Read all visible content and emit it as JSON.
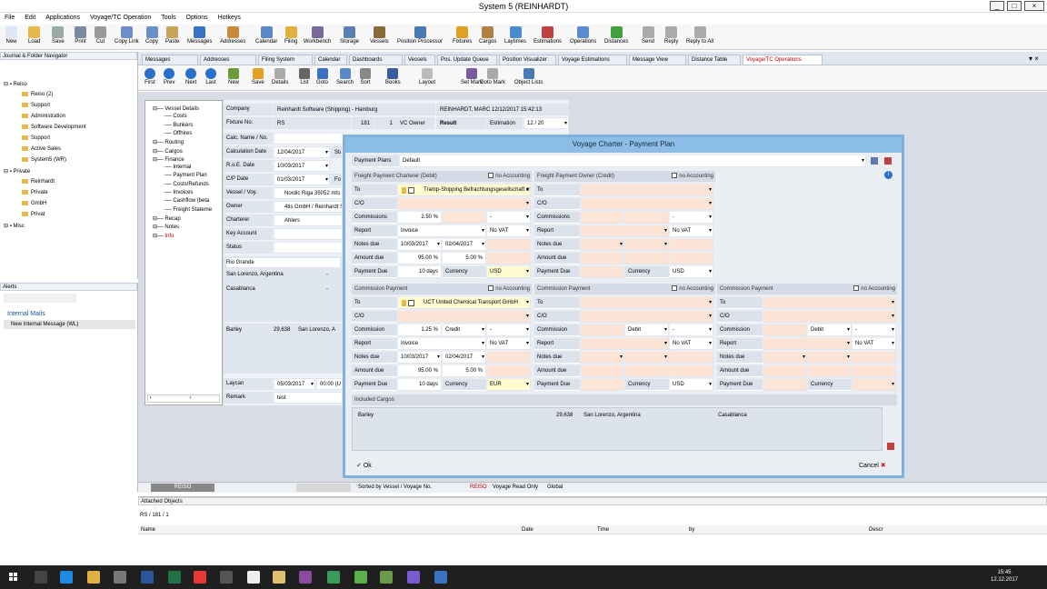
{
  "window": {
    "title": "System 5 (REINHARDT)",
    "min": "_",
    "max": "□",
    "close": "×"
  },
  "menu": [
    "File",
    "Edit",
    "Applications",
    "Voyage/TC Operation",
    "Tools",
    "Options",
    "Hotkeys"
  ],
  "ribbon": [
    "New",
    "Load",
    "Save",
    "Print",
    "Cut",
    "Copy Link",
    "Copy",
    "Paste",
    "Messages",
    "Addresses",
    "Calendar",
    "Filing",
    "Workbench",
    "Storage",
    "Vessels",
    "Position Processor",
    "Fixtures",
    "Cargos",
    "Laytimes",
    "Estimations",
    "Operations",
    "Distances",
    "Send",
    "Reply",
    "Reply to All"
  ],
  "nav": {
    "title": "Journal & Folder Navigator",
    "items": [
      {
        "label": "Reiso",
        "level": 0
      },
      {
        "label": "Reiso (2)",
        "level": 1
      },
      {
        "label": "Support",
        "level": 1
      },
      {
        "label": "Administration",
        "level": 1
      },
      {
        "label": "Software Development",
        "level": 1
      },
      {
        "label": "Support",
        "level": 1
      },
      {
        "label": "Active Sales",
        "level": 1
      },
      {
        "label": "System5 (WR)",
        "level": 1
      },
      {
        "label": "Private",
        "level": 0
      },
      {
        "label": "Reinhardt",
        "level": 1
      },
      {
        "label": "Private",
        "level": 1
      },
      {
        "label": "GmbH",
        "level": 1
      },
      {
        "label": "Privat",
        "level": 1
      },
      {
        "label": "Misc",
        "level": 0
      }
    ]
  },
  "alerts": {
    "title": "Alerts",
    "group": "Internal Mails",
    "message": "New Internal Message (WL)"
  },
  "tabs": [
    "Messages",
    "Addresses",
    "Filing System",
    "Calendar",
    "Dashboards",
    "Vessels",
    "Pos. Update Queue",
    "Position Visualizer",
    "Voyage Estimations",
    "Message View",
    "Distance Table",
    "Voyage/TC Operations"
  ],
  "toolbar": [
    "First",
    "Prev",
    "Next",
    "Last",
    "New",
    "Save",
    "Details",
    "List",
    "Goto",
    "Search",
    "Sort",
    "Books",
    "Layout",
    "Set Mark",
    "Goto Mark",
    "Object Lists"
  ],
  "tree": [
    "Vessel Details",
    "Costs",
    "Bunkers",
    "Offhires",
    "Routing",
    "Cargos",
    "Finance",
    "Internal",
    "Payment Plan",
    "Costs/Refunds",
    "Invoices",
    "Cashflow (beta",
    "Freight Stateme",
    "Recap",
    "Notes",
    "Info"
  ],
  "form": {
    "company_label": "Company",
    "company": "Reinhardt Software (Shipping) - Hamburg",
    "company_user": "REINHARDT, MARC  12/12/2017 15:42:13",
    "fixture_label": "Fixture No.",
    "fixture_a": "RS",
    "fixture_b": "181",
    "fixture_c": "1",
    "fixture_type": "VC Owner",
    "result_label": "Result",
    "estimation_label": "Estimation",
    "estimation": "12 / 20",
    "calc_label": "Calc. Name / No.",
    "calcdate_label": "Calculation Date",
    "calcdate": "12/04/2017",
    "sta": "Sta",
    "rde_label": "R.o.E. Date",
    "rde": "10/03/2017",
    "cp_label": "C/P Date",
    "cp": "01/03/2017",
    "for": "For",
    "vessel_label": "Vessel / Voy.",
    "vessel": "Nordic Riga  35052 mts D",
    "owner_label": "Owner",
    "owner": "4tis GmbH / Reinhardt So",
    "charterer_label": "Charterer",
    "charterer": "Ahlers",
    "key_label": "Key Account",
    "status_label": "Status",
    "ports": [
      "Rio Grande",
      "San Lorenzo, Argentina",
      "Casablanca"
    ],
    "cargo": "Barley",
    "cargo_qty": "29,638",
    "cargo_port": "San Lorenzo, A",
    "laycan_label": "Laycan",
    "laycan": "05/03/2017",
    "laycan_time": "00:00 (U",
    "remark_label": "Remark",
    "remark": "test"
  },
  "dialog": {
    "title": "Voyage Charter - Payment Plan",
    "plans_label": "Payment Plans",
    "plans": "Default",
    "fc_title": "Freight Payment Charterer (Debit)",
    "fo_title": "Freight Payment Owner (Credit)",
    "no_accounting": "no Accounting",
    "to": "To",
    "co": "C/O",
    "commissions": "Commissions",
    "commission": "Commission",
    "report": "Report",
    "notes_due": "Notes due",
    "amount_due": "Amount due",
    "payment_due": "Payment Due",
    "currency": "Currency",
    "fc_to": "Tramp-Shipping Befrachtungsgesellschaft mbH",
    "fc_comm": "2.50 %",
    "fc_comm_sel": "-",
    "fc_report": "Invoice",
    "fc_vat": "No VAT",
    "fc_notes1": "10/03/2017",
    "fc_notes2": "02/04/2017",
    "fc_amount1": "95.00 %",
    "fc_amount2": "5.00 %",
    "fc_days": "10 days",
    "fc_cur": "USD",
    "fo_comm_sel": "-",
    "fo_vat": "No VAT",
    "fo_cur": "USD",
    "cp_title": "Commission Payment",
    "c1_to": "UCT United Chemical Transport GmbH",
    "c1_comm": "1.25 %",
    "c1_credit": "Credit",
    "c1_sel": "-",
    "c1_report": "Invoice",
    "c1_vat": "No VAT",
    "c1_notes1": "10/03/2017",
    "c1_notes2": "02/04/2017",
    "c1_amount1": "95.00 %",
    "c1_amount2": "5.00 %",
    "c1_days": "10 days",
    "c1_cur": "EUR",
    "c2_debit": "Debit",
    "c2_sel": "-",
    "c2_vat": "No VAT",
    "c2_cur": "USD",
    "c3_debit": "Debit",
    "c3_sel": "-",
    "c3_vat": "No VAT",
    "included_cargos": "Included Cargos",
    "inc_cargo": "Barley",
    "inc_qty": "29,638",
    "inc_from": "San Lorenzo, Argentina",
    "inc_to": "Casablanca",
    "ok": "Ok",
    "cancel": "Cancel"
  },
  "status": {
    "left": "REISO",
    "sorted": "Sorted by Vessel / Voyage No.",
    "reiso": "REISO",
    "readonly": "Voyage Read Only",
    "global": "Global"
  },
  "attached": {
    "title": "Attached Objects",
    "path": "RS / 181 / 1",
    "cols": [
      "Name",
      "Date",
      "Time",
      "by",
      "Descr"
    ]
  },
  "taskbar": {
    "time": "15:45",
    "date": "12.12.2017"
  }
}
